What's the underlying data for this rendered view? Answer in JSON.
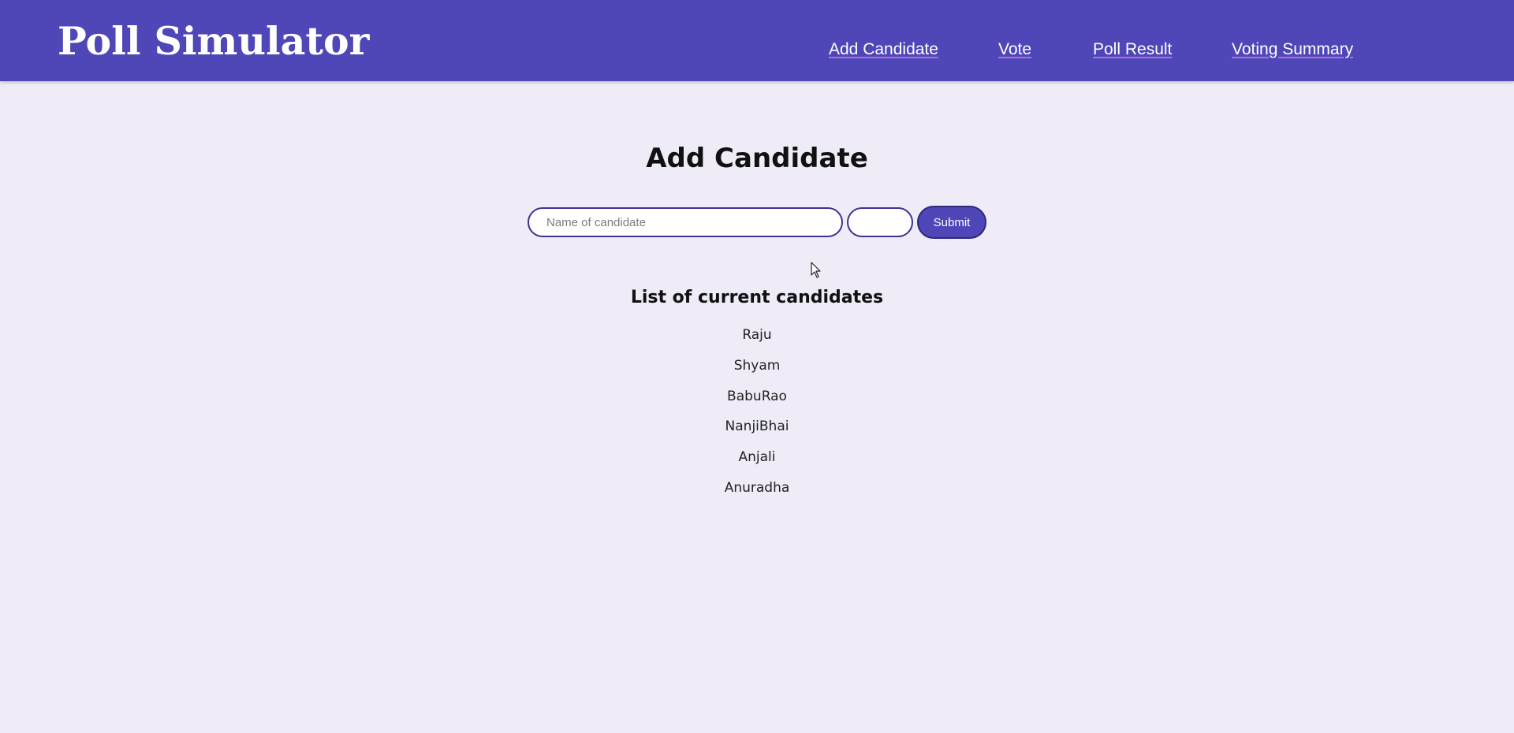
{
  "header": {
    "brand": "Poll Simulator",
    "nav": [
      {
        "label": "Add Candidate"
      },
      {
        "label": "Vote"
      },
      {
        "label": "Poll Result"
      },
      {
        "label": "Voting Summary"
      }
    ]
  },
  "main": {
    "title": "Add Candidate",
    "form": {
      "name_placeholder": "Name of candidate",
      "name_value": "",
      "second_value": "",
      "submit_label": "Submit"
    },
    "list_title": "List of current candidates",
    "candidates": [
      "Raju",
      "Shyam",
      "BabuRao",
      "NanjiBhai",
      "Anjali",
      "Anuradha"
    ]
  },
  "colors": {
    "header_bg": "#4f46b8",
    "page_bg": "#efecf7",
    "input_border": "#3c338f",
    "nav_underline": "#b66cd6"
  },
  "icons": {
    "cursor": "mouse-pointer-icon"
  }
}
